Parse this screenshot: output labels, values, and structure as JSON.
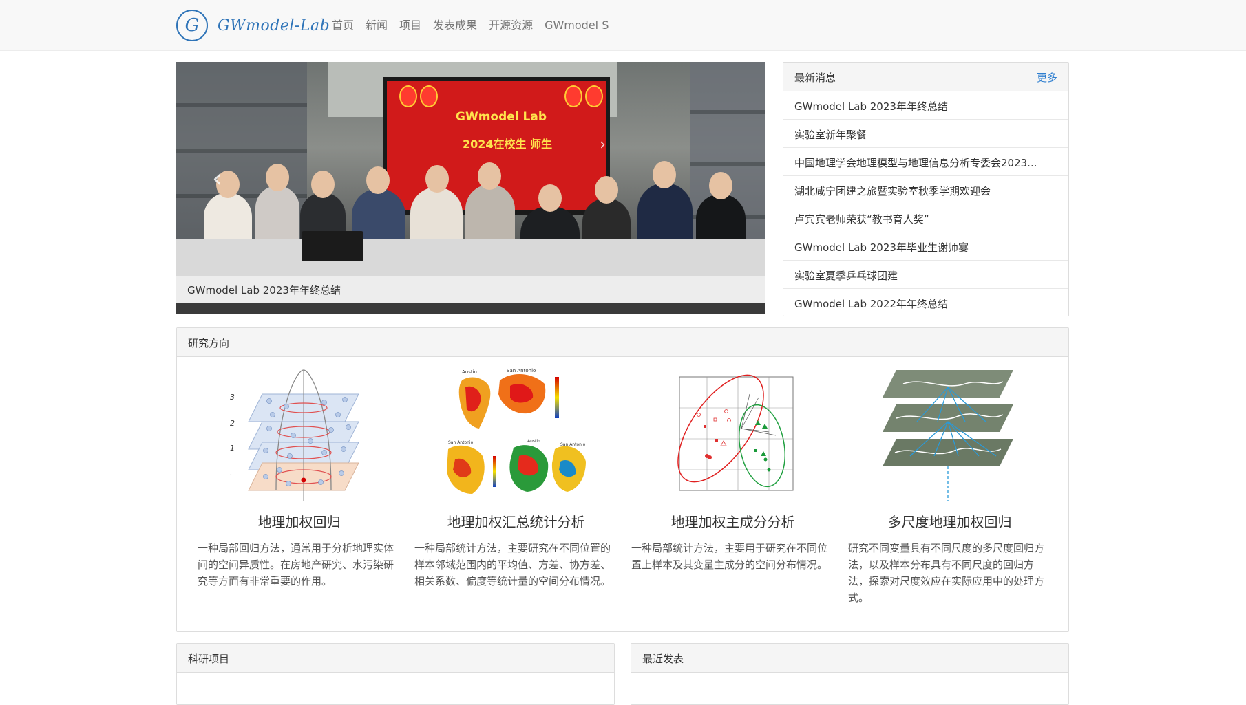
{
  "brand": {
    "logo_letter": "G",
    "name": "GWmodel-Lab"
  },
  "nav": {
    "items": [
      "首页",
      "新闻",
      "项目",
      "发表成果",
      "开源资源",
      "GWmodel S"
    ]
  },
  "carousel": {
    "caption": "GWmodel Lab 2023年年终总结",
    "screen_title": "GWmodel Lab",
    "screen_subtitle": "2024在校生 师生",
    "prev_icon": "‹",
    "next_icon": "›"
  },
  "news": {
    "heading": "最新消息",
    "more": "更多",
    "items": [
      "GWmodel Lab 2023年年终总结",
      "实验室新年聚餐",
      "中国地理学会地理模型与地理信息分析专委会2023...",
      "湖北咸宁团建之旅暨实验室秋季学期欢迎会",
      "卢宾宾老师荣获“教书育人奖”",
      "GWmodel Lab 2023年毕业生谢师宴",
      "实验室夏季乒乓球团建",
      "GWmodel Lab 2022年年终总结"
    ]
  },
  "research": {
    "heading": "研究方向",
    "cards": [
      {
        "title": "地理加权回归",
        "desc": "一种局部回归方法，通常用于分析地理实体间的空间异质性。在房地产研究、水污染研究等方面有非常重要的作用。",
        "fig_labels": [
          "3",
          "2",
          "1",
          "."
        ]
      },
      {
        "title": "地理加权汇总统计分析",
        "desc": "一种局部统计方法，主要研究在不同位置的样本邻域范围内的平均值、方差、协方差、相关系数、偏度等统计量的空间分布情况。",
        "fig_labels": [
          "Austin",
          "San Antonio",
          "San Antonio",
          "Austin",
          "San Antonio"
        ]
      },
      {
        "title": "地理加权主成分分析",
        "desc": "一种局部统计方法，主要用于研究在不同位置上样本及其变量主成分的空间分布情况。",
        "fig_labels": []
      },
      {
        "title": "多尺度地理加权回归",
        "desc": "研究不同变量具有不同尺度的多尺度回归方法，以及样本分布具有不同尺度的回归方法，探索对尺度效应在实际应用中的处理方式。",
        "fig_labels": []
      }
    ]
  },
  "projects": {
    "heading": "科研项目"
  },
  "publications": {
    "heading": "最近发表"
  },
  "colors": {
    "accent": "#2f74b8",
    "link": "#2f7fd0",
    "panel_heading_bg": "#f5f5f5",
    "border": "#dddddd"
  }
}
